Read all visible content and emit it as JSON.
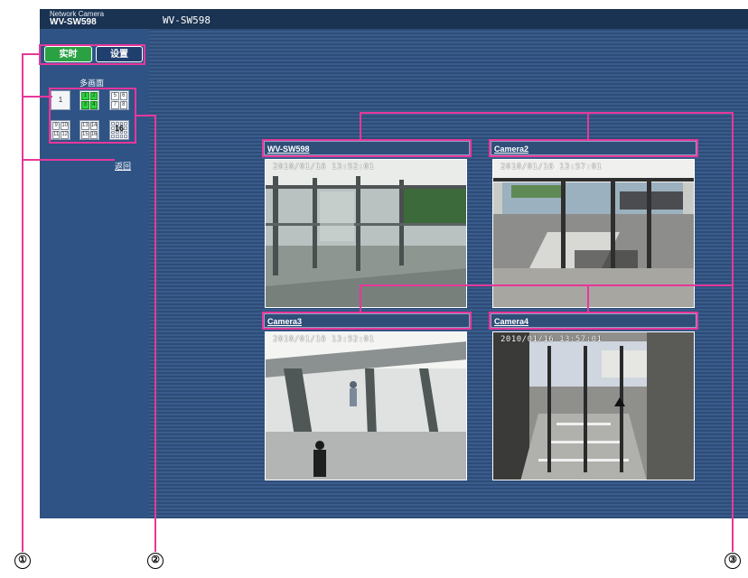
{
  "header": {
    "brand_sub": "Network Camera",
    "brand_model": "WV-SW598",
    "page_title": "WV-SW598"
  },
  "sidebar": {
    "tabs": {
      "live": "实时",
      "setup": "设置"
    },
    "multi_label": "多画面",
    "single_label": "1",
    "quad_a": [
      "1",
      "2",
      "3",
      "4"
    ],
    "quad_b": [
      "5",
      "6",
      "7",
      "8"
    ],
    "quad_c": [
      "9",
      "10",
      "11",
      "12"
    ],
    "quad_d": [
      "13",
      "14",
      "15",
      "16"
    ],
    "sixteen_label": "16",
    "back_link": "返回"
  },
  "cameras": [
    {
      "name": "WV-SW598",
      "timestamp": "2010/01/16 13:52:01"
    },
    {
      "name": "Camera2",
      "timestamp": "2010/01/16 13:57:01"
    },
    {
      "name": "Camera3",
      "timestamp": "2010/01/16 13:52:01"
    },
    {
      "name": "Camera4",
      "timestamp": "2010/01/16 13:57:01"
    }
  ],
  "callouts": [
    "①",
    "②",
    "③"
  ],
  "colors": {
    "live_tab": "#2aa244",
    "active_layout": "#2ed33e",
    "callout_line": "#e8379a"
  }
}
